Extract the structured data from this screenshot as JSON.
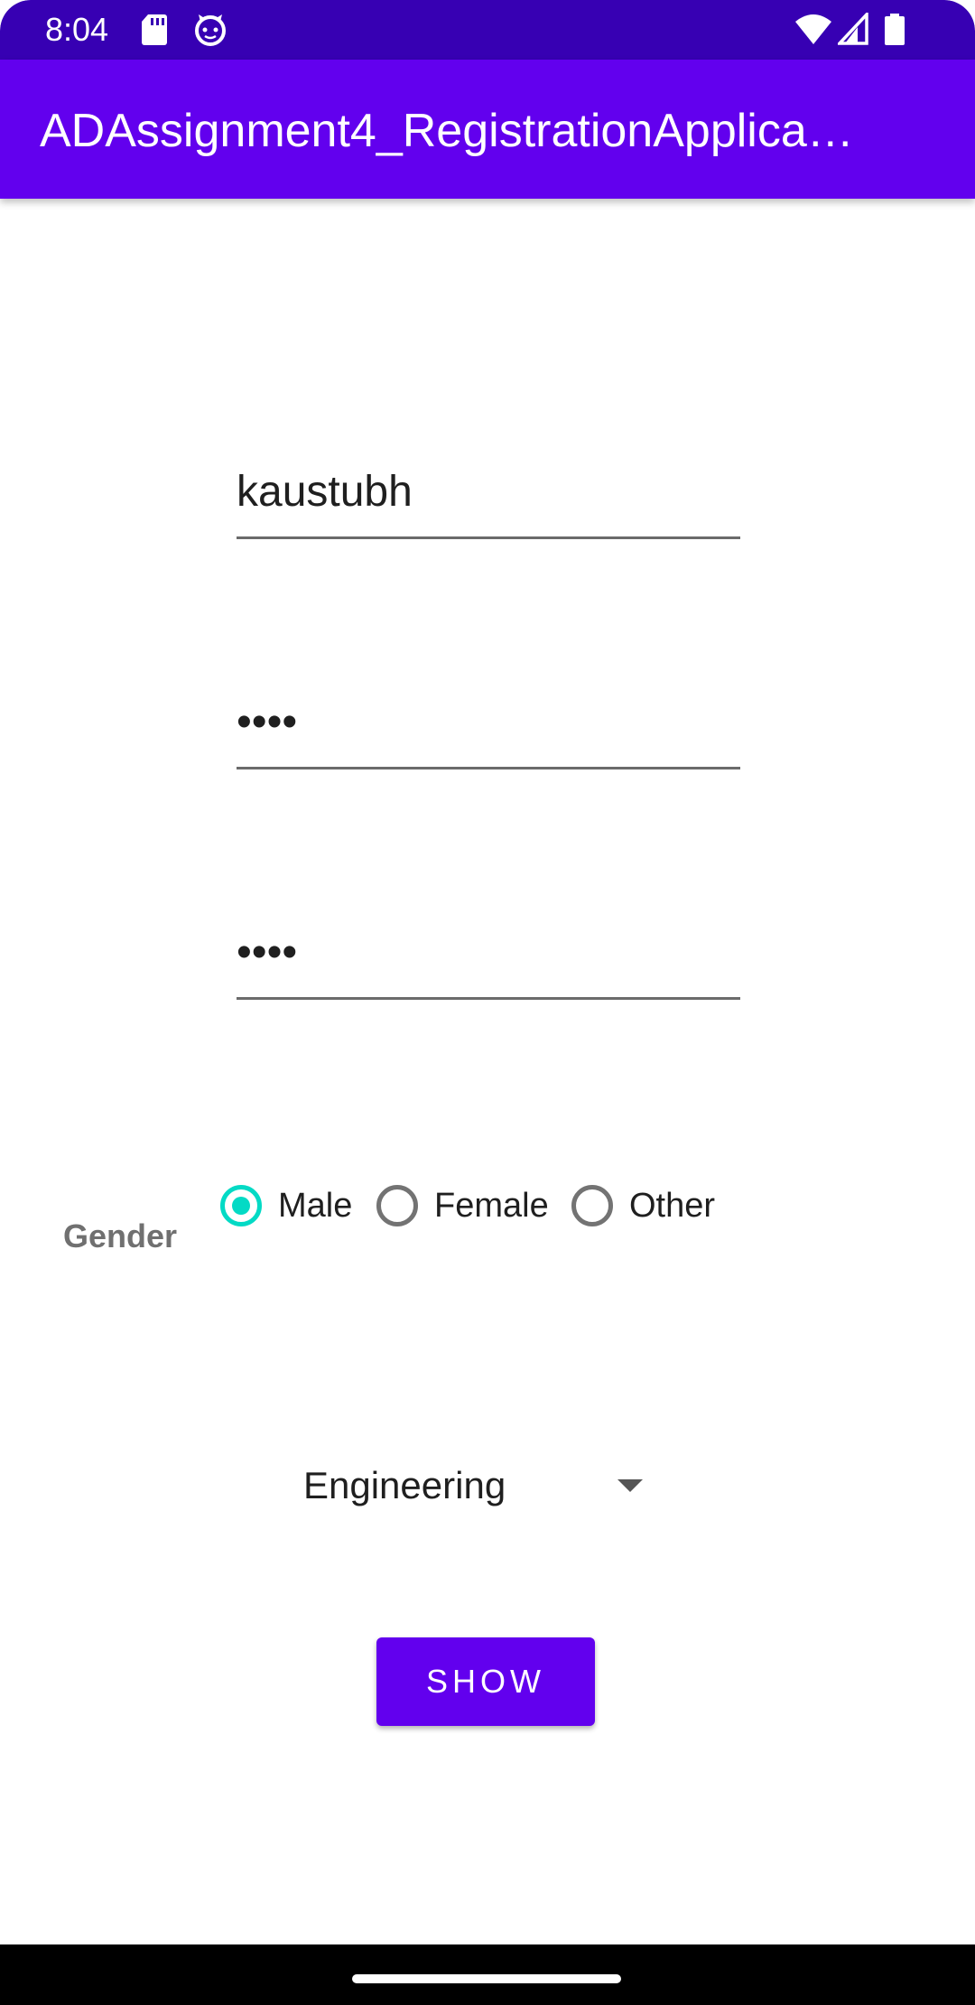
{
  "status_bar": {
    "time": "8:04",
    "icons_left": [
      "sd-card-icon",
      "notification-face-icon"
    ],
    "icons_right": [
      "wifi-icon",
      "signal-icon",
      "battery-icon"
    ]
  },
  "app_bar": {
    "title": "ADAssignment4_RegistrationApplica…"
  },
  "form": {
    "username": {
      "value": "kaustubh"
    },
    "password": {
      "value": "••••"
    },
    "confirm_password": {
      "value": "••••"
    },
    "gender": {
      "label": "Gender",
      "options": [
        {
          "label": "Male",
          "checked": true
        },
        {
          "label": "Female",
          "checked": false
        },
        {
          "label": "Other",
          "checked": false
        }
      ]
    },
    "department": {
      "selected": "Engineering"
    },
    "show_button": {
      "label": "SHOW"
    }
  },
  "colors": {
    "status_bar": "#3700b3",
    "app_bar": "#6200ee",
    "accent": "#03dac5",
    "button": "#6200ee"
  }
}
